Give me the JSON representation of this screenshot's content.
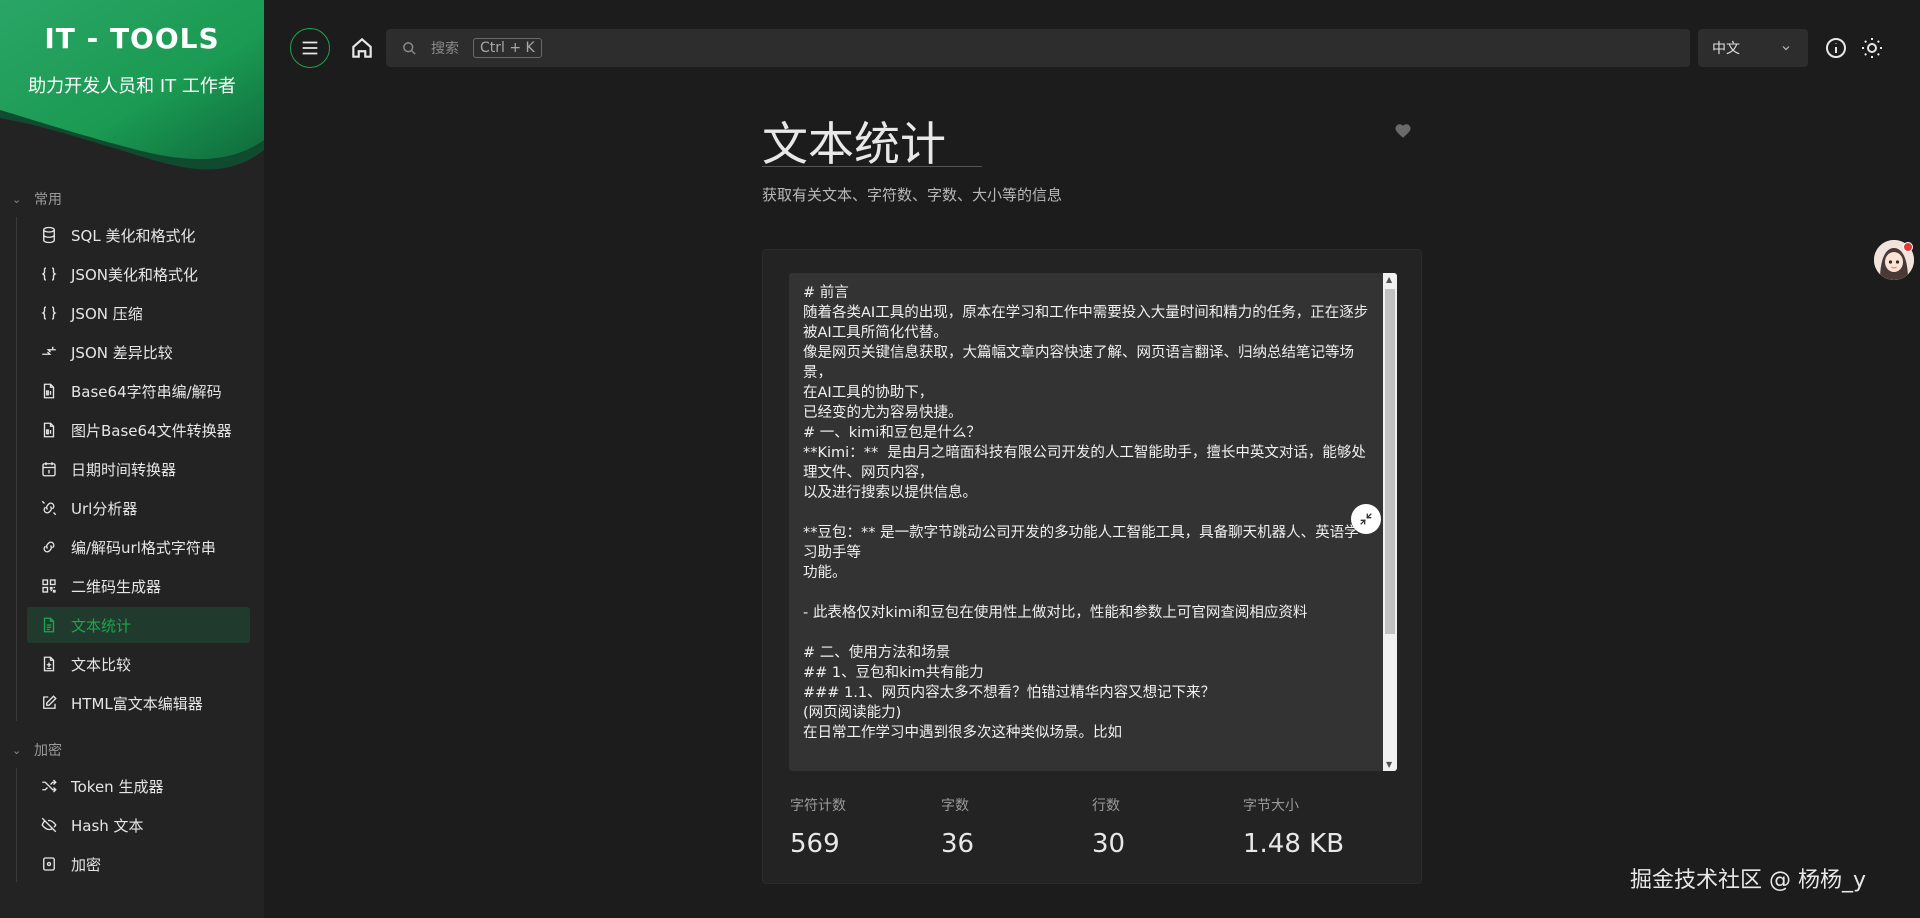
{
  "brand": {
    "title": "IT - TOOLS",
    "subtitle": "助力开发人员和 IT 工作者"
  },
  "colors": {
    "accent": "#1ea54c",
    "background": "#1c1c1c",
    "sidebar": "#232323"
  },
  "sidebar": {
    "groups": [
      {
        "label": "常用",
        "items": [
          {
            "label": "SQL 美化和格式化",
            "icon": "database-icon"
          },
          {
            "label": "JSON美化和格式化",
            "icon": "braces-icon"
          },
          {
            "label": "JSON 压缩",
            "icon": "braces-icon"
          },
          {
            "label": "JSON 差异比较",
            "icon": "compare-icon"
          },
          {
            "label": "Base64字符串编/解码",
            "icon": "file-binary-icon"
          },
          {
            "label": "图片Base64文件转换器",
            "icon": "file-image-icon"
          },
          {
            "label": "日期时间转换器",
            "icon": "calendar-icon"
          },
          {
            "label": "Url分析器",
            "icon": "unlink-icon"
          },
          {
            "label": "编/解码url格式字符串",
            "icon": "link-icon"
          },
          {
            "label": "二维码生成器",
            "icon": "qrcode-icon"
          },
          {
            "label": "文本统计",
            "icon": "file-text-icon",
            "active": true
          },
          {
            "label": "文本比较",
            "icon": "file-diff-icon"
          },
          {
            "label": "HTML富文本编辑器",
            "icon": "edit-icon"
          }
        ]
      },
      {
        "label": "加密",
        "items": [
          {
            "label": "Token 生成器",
            "icon": "shuffle-icon"
          },
          {
            "label": "Hash 文本",
            "icon": "eye-off-icon"
          },
          {
            "label": "加密",
            "icon": "lock-icon"
          }
        ]
      }
    ]
  },
  "topbar": {
    "search_placeholder": "搜索",
    "search_shortcut": "Ctrl + K",
    "language": "中文"
  },
  "page": {
    "title": "文本统计",
    "description": "获取有关文本、字符数、字数、大小等的信息"
  },
  "textarea": {
    "value": "# 前言\n随着各类AI工具的出现，原本在学习和工作中需要投入大量时间和精力的任务，正在逐步被AI工具所简化代替。\n像是网页关键信息获取，大篇幅文章内容快速了解、网页语言翻译、归纳总结笔记等场景，\n在AI工具的协助下，\n已经变的尤为容易快捷。\n# 一、kimi和豆包是什么？\n**Kimi：**  是由月之暗面科技有限公司开发的人工智能助手，擅长中英文对话，能够处理文件、网页内容，\n以及进行搜索以提供信息。\n\n**豆包：** 是一款字节跳动公司开发的多功能人工智能工具，具备聊天机器人、英语学习助手等\n功能。\n\n- 此表格仅对kimi和豆包在使用性上做对比，性能和参数上可官网查阅相应资料\n\n# 二、使用方法和场景\n## 1、豆包和kim共有能力\n### 1.1、网页内容太多不想看？怕错过精华内容又想记下来？\n(网页阅读能力)\n在日常工作学习中遇到很多次这种类似场景。比如"
  },
  "stats": [
    {
      "label": "字符计数",
      "value": "569"
    },
    {
      "label": "字数",
      "value": "36"
    },
    {
      "label": "行数",
      "value": "30"
    },
    {
      "label": "字节大小",
      "value": "1.48 KB"
    }
  ],
  "watermark": "掘金技术社区 @ 杨杨_y"
}
